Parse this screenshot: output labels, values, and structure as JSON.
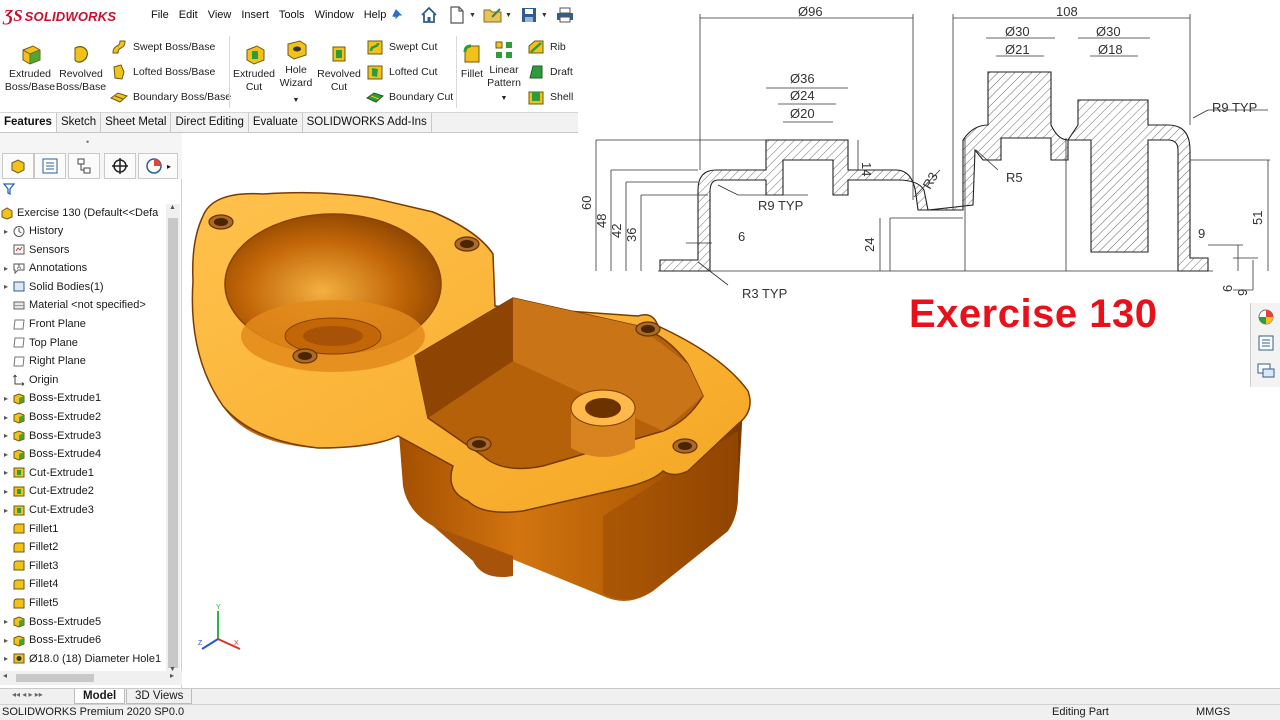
{
  "app": {
    "brand": "SOLIDWORKS",
    "menu": [
      "File",
      "Edit",
      "View",
      "Insert",
      "Tools",
      "Window",
      "Help"
    ]
  },
  "ribbon": {
    "extruded_boss": [
      "Extruded",
      "Boss/Base"
    ],
    "revolved_boss": [
      "Revolved",
      "Boss/Base"
    ],
    "swept_boss": "Swept Boss/Base",
    "lofted_boss": "Lofted Boss/Base",
    "boundary_boss": "Boundary Boss/Base",
    "extruded_cut": [
      "Extruded",
      "Cut"
    ],
    "hole_wizard": [
      "Hole",
      "Wizard"
    ],
    "revolved_cut": [
      "Revolved",
      "Cut"
    ],
    "swept_cut": "Swept Cut",
    "lofted_cut": "Lofted Cut",
    "boundary_cut": "Boundary Cut",
    "fillet": "Fillet",
    "linear_pattern": [
      "Linear",
      "Pattern"
    ],
    "rib": "Rib",
    "draft": "Draft",
    "shell": "Shell"
  },
  "tabs": [
    "Features",
    "Sketch",
    "Sheet Metal",
    "Direct Editing",
    "Evaluate",
    "SOLIDWORKS Add-Ins"
  ],
  "feature_tree": {
    "root": "Exercise 130  (Default<<Defa",
    "items": [
      {
        "label": "History",
        "icon": "history-icon",
        "exp": true
      },
      {
        "label": "Sensors",
        "icon": "sensor-icon",
        "exp": false
      },
      {
        "label": "Annotations",
        "icon": "annotation-icon",
        "exp": true
      },
      {
        "label": "Solid Bodies(1)",
        "icon": "solid-bodies-icon",
        "exp": true
      },
      {
        "label": "Material <not specified>",
        "icon": "material-icon",
        "exp": false
      },
      {
        "label": "Front Plane",
        "icon": "plane-icon",
        "exp": false
      },
      {
        "label": "Top Plane",
        "icon": "plane-icon",
        "exp": false
      },
      {
        "label": "Right Plane",
        "icon": "plane-icon",
        "exp": false
      },
      {
        "label": "Origin",
        "icon": "origin-icon",
        "exp": false
      },
      {
        "label": "Boss-Extrude1",
        "icon": "boss-extrude-icon",
        "exp": true
      },
      {
        "label": "Boss-Extrude2",
        "icon": "boss-extrude-icon",
        "exp": true
      },
      {
        "label": "Boss-Extrude3",
        "icon": "boss-extrude-icon",
        "exp": true
      },
      {
        "label": "Boss-Extrude4",
        "icon": "boss-extrude-icon",
        "exp": true
      },
      {
        "label": "Cut-Extrude1",
        "icon": "cut-extrude-icon",
        "exp": true
      },
      {
        "label": "Cut-Extrude2",
        "icon": "cut-extrude-icon",
        "exp": true
      },
      {
        "label": "Cut-Extrude3",
        "icon": "cut-extrude-icon",
        "exp": true
      },
      {
        "label": "Fillet1",
        "icon": "fillet-icon",
        "exp": false
      },
      {
        "label": "Fillet2",
        "icon": "fillet-icon",
        "exp": false
      },
      {
        "label": "Fillet3",
        "icon": "fillet-icon",
        "exp": false
      },
      {
        "label": "Fillet4",
        "icon": "fillet-icon",
        "exp": false
      },
      {
        "label": "Fillet5",
        "icon": "fillet-icon",
        "exp": false
      },
      {
        "label": "Boss-Extrude5",
        "icon": "boss-extrude-icon",
        "exp": true
      },
      {
        "label": "Boss-Extrude6",
        "icon": "boss-extrude-icon",
        "exp": true
      },
      {
        "label": "Ø18.0 (18) Diameter Hole1",
        "icon": "hole-icon",
        "exp": true
      }
    ]
  },
  "bottom_tabs": [
    "Model",
    "3D Views"
  ],
  "status": {
    "left": "SOLIDWORKS Premium 2020 SP0.0",
    "mode": "Editing Part",
    "units": "MMGS"
  },
  "drawing": {
    "d96": "Ø96",
    "d108": "108",
    "d30a": "Ø30",
    "d21": "Ø21",
    "d30b": "Ø30",
    "d18": "Ø18",
    "d36": "Ø36",
    "d24": "Ø24",
    "d20": "Ø20",
    "r9typ_right": "R9 TYP",
    "r9typ_left": "R9 TYP",
    "r3typ": "R3 TYP",
    "r3": "R3",
    "r5": "R5",
    "v14": "14",
    "v60": "60",
    "v48": "48",
    "v42": "42",
    "v36": "36",
    "v24": "24",
    "v6": "6",
    "v51": "51",
    "v9a": "9",
    "v6b": "6",
    "v9b": "9"
  },
  "title": "Exercise 130",
  "triad": {
    "x": "X",
    "y": "Y",
    "z": "Z"
  },
  "colors": {
    "part": "#f5a623",
    "brand_red": "#c8102e",
    "title_red": "#e8111a"
  }
}
